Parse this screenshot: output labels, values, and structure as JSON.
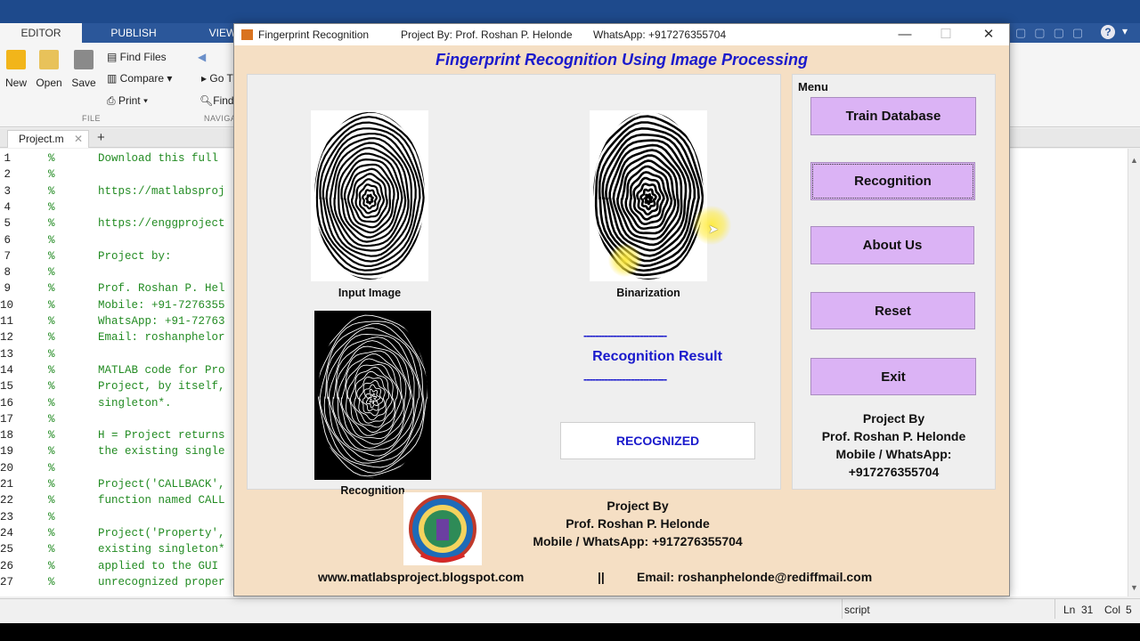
{
  "matlab": {
    "ribbon_tabs": [
      "EDITOR",
      "PUBLISH",
      "VIEW"
    ],
    "tools": {
      "new": "New",
      "open": "Open",
      "save": "Save",
      "find_files": "Find Files",
      "compare": "Compare",
      "print": "Print",
      "go_to": "Go T",
      "find": "Find",
      "section_file": "FILE",
      "section_navigate": "NAVIGA"
    },
    "file_tab": "Project.m",
    "add_tab": "+",
    "code_lines": [
      {
        "n": "1",
        "text": "Download this full"
      },
      {
        "n": "2",
        "text": ""
      },
      {
        "n": "3",
        "text": "https://matlabsproj"
      },
      {
        "n": "4",
        "text": ""
      },
      {
        "n": "5",
        "text": "https://enggproject"
      },
      {
        "n": "6",
        "text": ""
      },
      {
        "n": "7",
        "text": "Project by:"
      },
      {
        "n": "8",
        "text": ""
      },
      {
        "n": "9",
        "text": "Prof. Roshan P. Hel"
      },
      {
        "n": "10",
        "text": "Mobile: +91-7276355"
      },
      {
        "n": "11",
        "text": "WhatsApp: +91-72763"
      },
      {
        "n": "12",
        "text": "Email: roshanphelor"
      },
      {
        "n": "13",
        "text": ""
      },
      {
        "n": "14",
        "text": "MATLAB code for Pro"
      },
      {
        "n": "15",
        "text": "Project, by itself,"
      },
      {
        "n": "16",
        "text": "singleton*."
      },
      {
        "n": "17",
        "text": ""
      },
      {
        "n": "18",
        "text": "H = Project returns"
      },
      {
        "n": "19",
        "text": "the existing single"
      },
      {
        "n": "20",
        "text": ""
      },
      {
        "n": "21",
        "text": "Project('CALLBACK',"
      },
      {
        "n": "22",
        "text": "function named CALL"
      },
      {
        "n": "23",
        "text": ""
      },
      {
        "n": "24",
        "text": "Project('Property',"
      },
      {
        "n": "25",
        "text": "existing singleton*"
      },
      {
        "n": "26",
        "text": "applied to the GUI"
      },
      {
        "n": "27",
        "text": "unrecognized proper"
      }
    ],
    "status": {
      "mode": "script",
      "ln": "Ln",
      "ln_val": "31",
      "col": "Col",
      "col_val": "5"
    }
  },
  "figure": {
    "window_title": "Fingerprint Recognition",
    "project_by": "Project By: Prof. Roshan P. Helonde",
    "whatsapp": "WhatsApp: +917276355704",
    "heading": "Fingerprint Recognition Using Image Processing",
    "captions": {
      "input": "Input Image",
      "binarization": "Binarization",
      "recognition": "Recognition"
    },
    "result": {
      "dashes": "----------------------------",
      "title": "Recognition Result",
      "value": "RECOGNIZED"
    },
    "menu": {
      "title": "Menu",
      "buttons": [
        "Train Database",
        "Recognition",
        "About Us",
        "Reset",
        "Exit"
      ]
    },
    "side_credit": [
      "Project By",
      "Prof. Roshan P. Helonde",
      "Mobile / WhatsApp:",
      "+917276355704"
    ],
    "bottom_credit": [
      "Project By",
      "Prof. Roshan P. Helonde",
      "Mobile / WhatsApp: +917276355704"
    ],
    "website": "www.matlabsproject.blogspot.com",
    "separator": "||",
    "email": "Email: roshanphelonde@rediffmail.com",
    "window_buttons": {
      "minimize": "—",
      "maximize": "☐",
      "close": "✕"
    },
    "colors": {
      "background": "#f5dfc4",
      "button": "#dbb3f5",
      "heading": "#1a1acc"
    }
  }
}
